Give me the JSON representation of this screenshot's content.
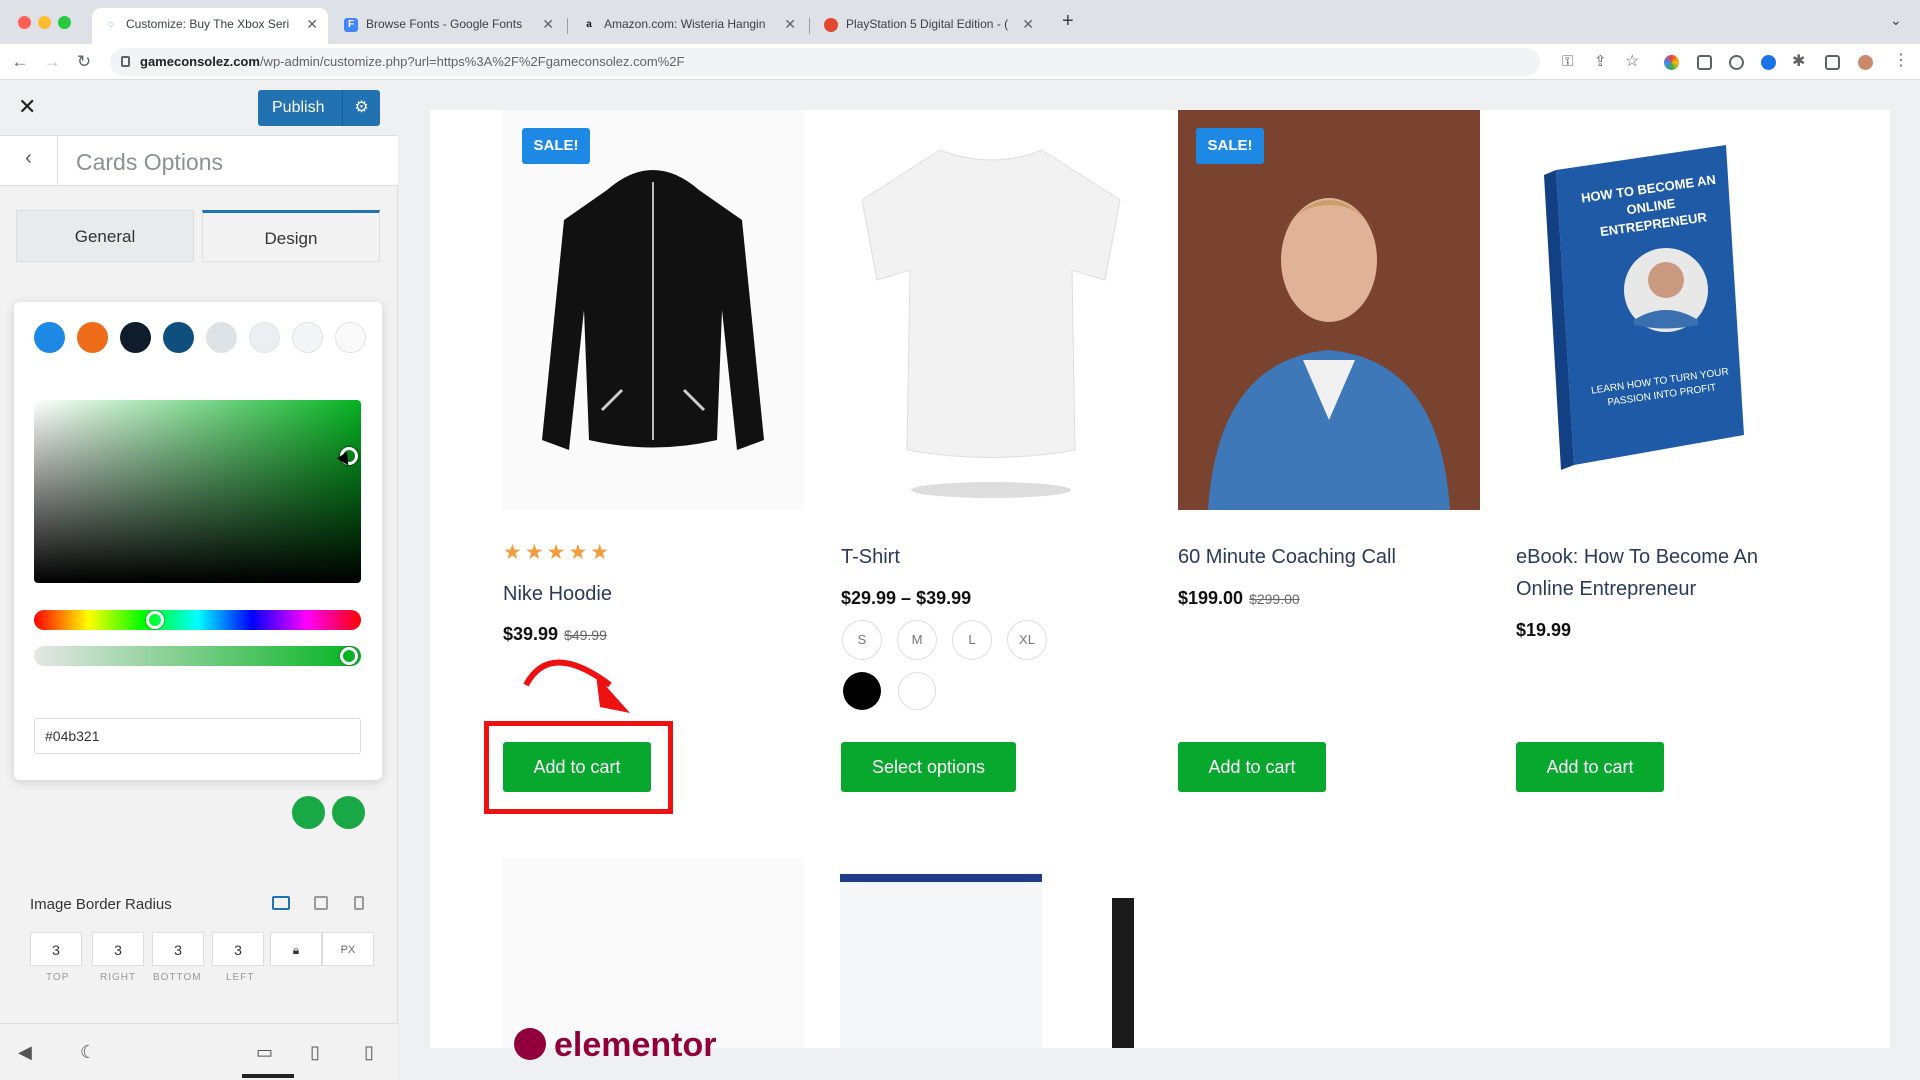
{
  "browser": {
    "tabs": [
      {
        "title": "Customize: Buy The Xbox Seri",
        "active": true
      },
      {
        "title": "Browse Fonts - Google Fonts",
        "active": false
      },
      {
        "title": "Amazon.com: Wisteria Hangin",
        "active": false
      },
      {
        "title": "PlayStation 5 Digital Edition - (",
        "active": false
      }
    ],
    "url_host": "gameconsolez.com",
    "url_path": "/wp-admin/customize.php?url=https%3A%2F%2Fgameconsolez.com%2F"
  },
  "customizer": {
    "publish_label": "Publish",
    "section_title": "Cards Options",
    "tab_general": "General",
    "tab_design": "Design",
    "palette": [
      "#1e88e5",
      "#ef6c1a",
      "#0f1c2b",
      "#0e4f7d",
      "#dde2e6",
      "#eceff1",
      "#f4f5f6",
      "#fafafa"
    ],
    "hex_value": "#04b321",
    "image_border_radius_label": "Image Border Radius",
    "radius": {
      "top": "3",
      "right": "3",
      "bottom": "3",
      "left": "3",
      "unit": "PX"
    },
    "radius_labels": {
      "top": "TOP",
      "right": "RIGHT",
      "bottom": "BOTTOM",
      "left": "LEFT"
    }
  },
  "products": [
    {
      "name": "Nike Hoodie",
      "price": "$39.99",
      "old_price": "$49.99",
      "sale": "SALE!",
      "rating_stars": "★★★★★",
      "button": "Add to cart"
    },
    {
      "name": "T-Shirt",
      "price": "$29.99 – $39.99",
      "sizes": [
        "S",
        "M",
        "L",
        "XL"
      ],
      "colors": [
        "#000000",
        "#ffffff"
      ],
      "button": "Select options"
    },
    {
      "name": "60 Minute Coaching Call",
      "price": "$199.00",
      "old_price": "$299.00",
      "sale": "SALE!",
      "button": "Add to cart"
    },
    {
      "name": "eBook: How To Become An Online Entrepreneur",
      "price": "$19.99",
      "button": "Add to cart"
    }
  ],
  "ebook_cover_title": "HOW TO BECOME AN ONLINE ENTREPRENEUR",
  "ebook_cover_sub": "LEARN HOW TO TURN YOUR PASSION INTO PROFIT",
  "partial_text": "elementor"
}
